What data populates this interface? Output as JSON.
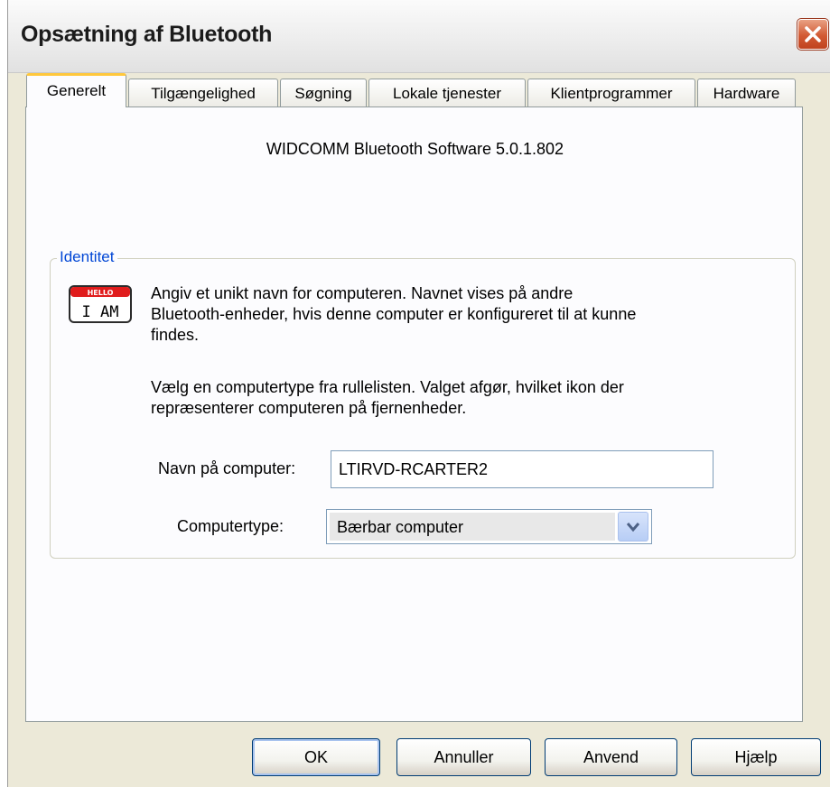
{
  "window": {
    "title": "Opsætning af Bluetooth"
  },
  "tabs": [
    {
      "label": "Generelt",
      "active": true
    },
    {
      "label": "Tilgængelighed"
    },
    {
      "label": "Søgning"
    },
    {
      "label": "Lokale tjenester"
    },
    {
      "label": "Klientprogrammer"
    },
    {
      "label": "Hardware"
    }
  ],
  "general": {
    "version": "WIDCOMM Bluetooth Software 5.0.1.802",
    "identity": {
      "group_label": "Identitet",
      "icon_text": "I AM",
      "icon_banner": "HELLO",
      "para1_lines": [
        "Angiv et unikt navn for computeren. Navnet vises på andre",
        "Bluetooth-enheder, hvis denne computer er konfigureret til at kunne",
        "findes."
      ],
      "para2_lines": [
        "Vælg en computertype fra rullelisten. Valget afgør, hvilket ikon der",
        "repræsenterer computeren på fjernenheder."
      ],
      "name_label": "Navn på computer:",
      "name_value": "LTIRVD-RCARTER2",
      "type_label": "Computertype:",
      "type_value": "Bærbar computer"
    }
  },
  "buttons": {
    "ok": "OK",
    "cancel": "Annuller",
    "apply": "Anvend",
    "help": "Hjælp"
  },
  "colors": {
    "group_label": "#0046d5",
    "active_tab_accent": "#ffc83c",
    "close_button": "#d25a33"
  }
}
